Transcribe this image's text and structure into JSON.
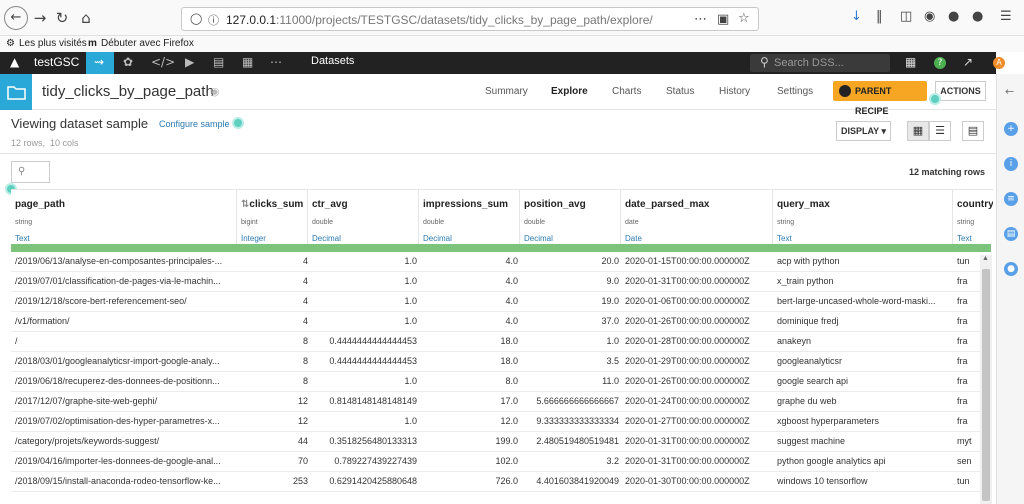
{
  "browser": {
    "url_host": "127.0.0.1",
    "url_rest": ":11000/projects/TESTGSC/datasets/tidy_clicks_by_page_path/explore/",
    "bookmarks": [
      "Les plus visités",
      "Débuter avec Firefox"
    ]
  },
  "app_nav": {
    "project": "testGSC",
    "section": "Datasets",
    "search_placeholder": "Search DSS...",
    "user_initial": "A"
  },
  "dataset": {
    "name": "tidy_clicks_by_page_path",
    "tabs": [
      "Summary",
      "Explore",
      "Charts",
      "Status",
      "History",
      "Settings"
    ],
    "active_tab": "Explore",
    "parent_recipe_label": "PARENT RECIPE",
    "actions_label": "ACTIONS"
  },
  "sample": {
    "title": "Viewing dataset sample",
    "configure_label": "Configure sample",
    "rows_label": "12 rows,",
    "cols_label": "10 cols",
    "display_label": "DISPLAY",
    "matching_label": "12 matching rows"
  },
  "columns": [
    {
      "name": "page_path",
      "type": "string",
      "meaning": "Text"
    },
    {
      "name": "clicks_sum",
      "type": "bigint",
      "meaning": "Integer"
    },
    {
      "name": "ctr_avg",
      "type": "double",
      "meaning": "Decimal"
    },
    {
      "name": "impressions_sum",
      "type": "double",
      "meaning": "Decimal"
    },
    {
      "name": "position_avg",
      "type": "double",
      "meaning": "Decimal"
    },
    {
      "name": "date_parsed_max",
      "type": "date",
      "meaning": "Date"
    },
    {
      "name": "query_max",
      "type": "string",
      "meaning": "Text"
    },
    {
      "name": "country_",
      "type": "string",
      "meaning": "Text"
    }
  ],
  "rows": [
    [
      "/2019/06/13/analyse-en-composantes-principales-...",
      "4",
      "1.0",
      "4.0",
      "20.0",
      "2020-01-15T00:00:00.000000Z",
      "acp with python",
      "tun"
    ],
    [
      "/2019/07/01/classification-de-pages-via-le-machin...",
      "4",
      "1.0",
      "4.0",
      "9.0",
      "2020-01-31T00:00:00.000000Z",
      "x_train python",
      "fra"
    ],
    [
      "/2019/12/18/score-bert-referencement-seo/",
      "4",
      "1.0",
      "4.0",
      "19.0",
      "2020-01-06T00:00:00.000000Z",
      "bert-large-uncased-whole-word-maski...",
      "fra"
    ],
    [
      "/v1/formation/",
      "4",
      "1.0",
      "4.0",
      "37.0",
      "2020-01-26T00:00:00.000000Z",
      "dominique fredj",
      "fra"
    ],
    [
      "/",
      "8",
      "0.4444444444444453",
      "18.0",
      "1.0",
      "2020-01-28T00:00:00.000000Z",
      "anakeyn",
      "fra"
    ],
    [
      "/2018/03/01/googleanalyticsr-import-google-analy...",
      "8",
      "0.4444444444444453",
      "18.0",
      "3.5",
      "2020-01-29T00:00:00.000000Z",
      "googleanalyticsr",
      "fra"
    ],
    [
      "/2019/06/18/recuperez-des-donnees-de-positionn...",
      "8",
      "1.0",
      "8.0",
      "11.0",
      "2020-01-26T00:00:00.000000Z",
      "google search api",
      "fra"
    ],
    [
      "/2017/12/07/graphe-site-web-gephi/",
      "12",
      "0.8148148148148149",
      "17.0",
      "5.666666666666667",
      "2020-01-24T00:00:00.000000Z",
      "graphe du web",
      "fra"
    ],
    [
      "/2019/07/02/optimisation-des-hyper-parametres-x...",
      "12",
      "1.0",
      "12.0",
      "9.333333333333334",
      "2020-01-27T00:00:00.000000Z",
      "xgboost hyperparameters",
      "fra"
    ],
    [
      "/category/projets/keywords-suggest/",
      "44",
      "0.3518256480133313",
      "199.0",
      "2.480519480519481",
      "2020-01-31T00:00:00.000000Z",
      "suggest machine",
      "myt"
    ],
    [
      "/2019/04/16/importer-les-donnees-de-google-anal...",
      "70",
      "0.789227439227439",
      "102.0",
      "3.2",
      "2020-01-31T00:00:00.000000Z",
      "python google analytics api",
      "sen"
    ],
    [
      "/2018/09/15/install-anaconda-rodeo-tensorflow-ke...",
      "253",
      "0.6291420425880648",
      "726.0",
      "4.401603841920049",
      "2020-01-30T00:00:00.000000Z",
      "windows 10 tensorflow",
      "tun"
    ]
  ]
}
